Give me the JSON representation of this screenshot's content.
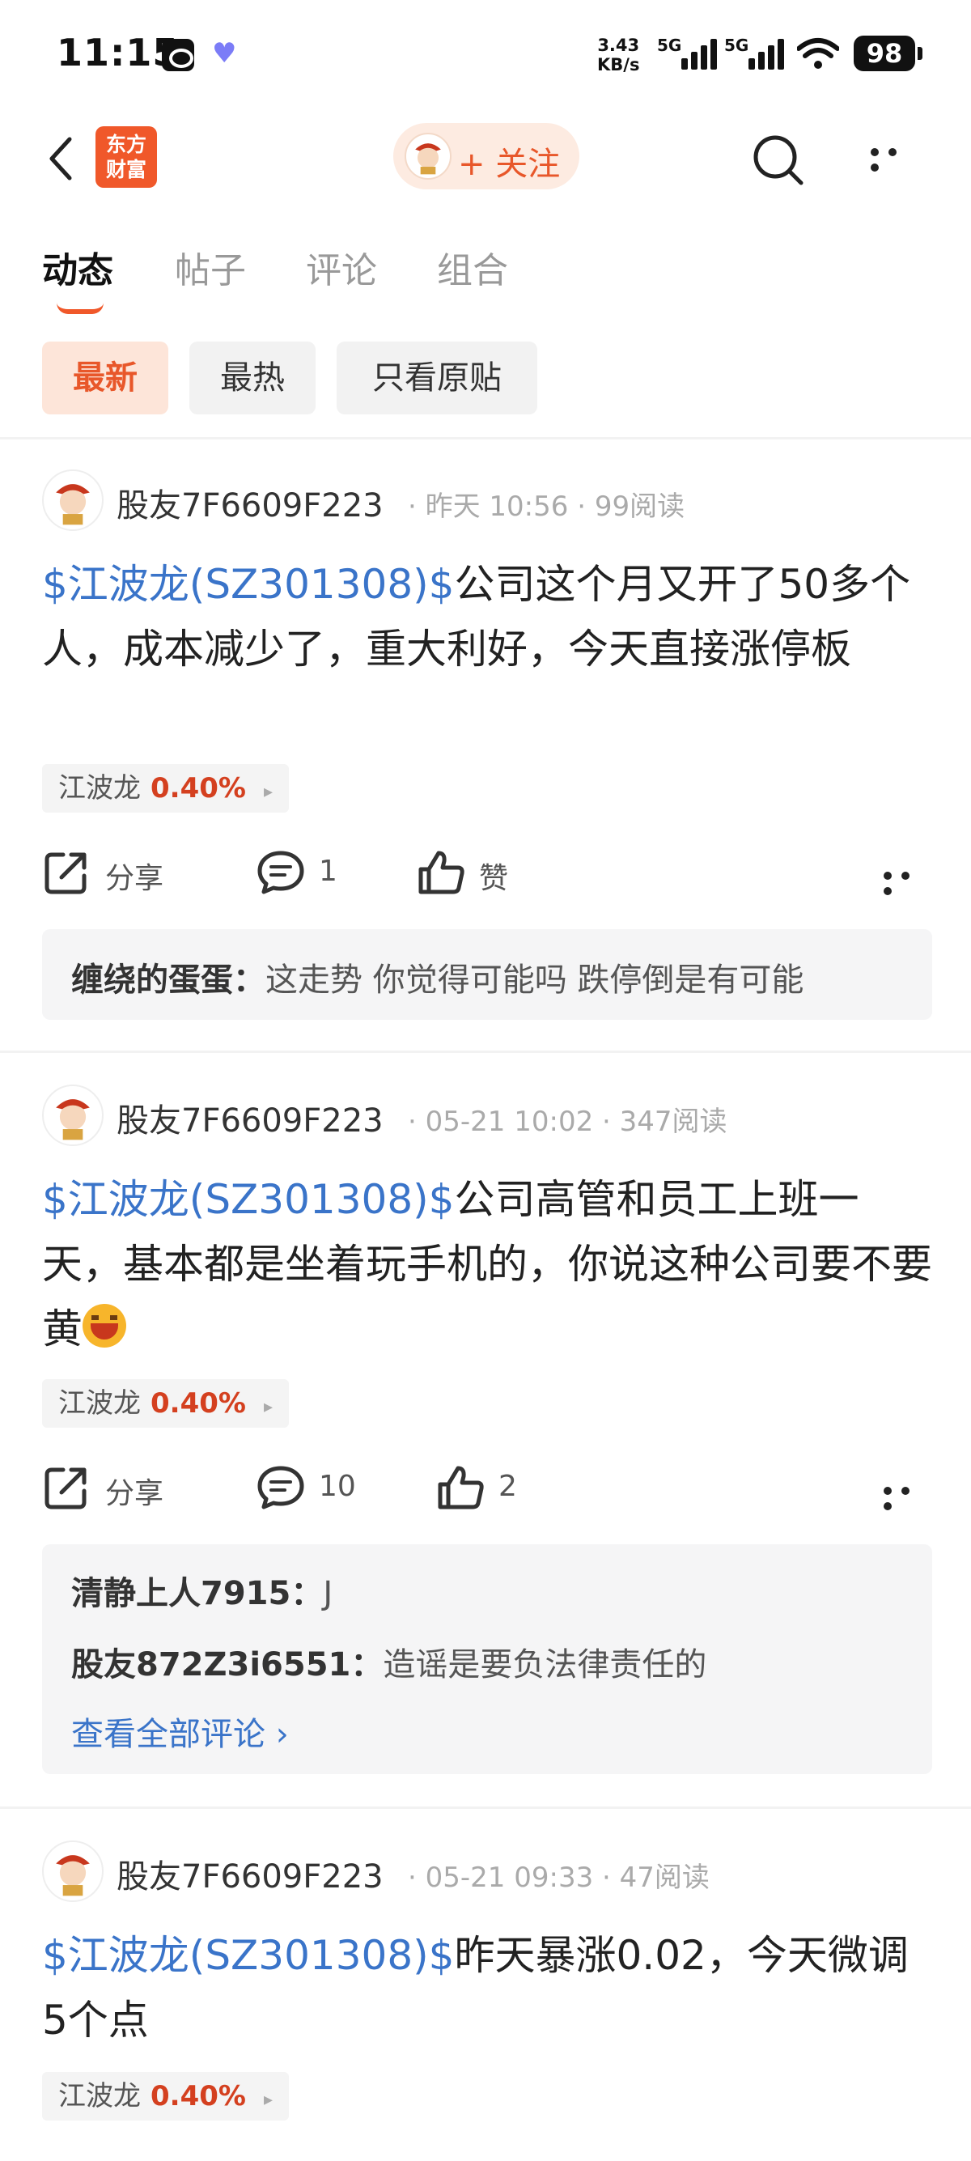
{
  "status_bar": {
    "time": "11:15",
    "net_speed_value": "3.43",
    "net_speed_unit": "KB/s",
    "signal1_label": "5G",
    "signal2_label": "5G",
    "battery": "98"
  },
  "nav": {
    "brand_line1": "东方",
    "brand_line2": "财富",
    "follow_label": "+ 关注"
  },
  "tabs": [
    {
      "label": "动态",
      "active": true
    },
    {
      "label": "帖子"
    },
    {
      "label": "评论"
    },
    {
      "label": "组合"
    }
  ],
  "filters": [
    {
      "label": "最新",
      "active": true
    },
    {
      "label": "最热"
    },
    {
      "label": "只看原贴"
    }
  ],
  "posts": [
    {
      "author": "股友7F6609F223",
      "meta": "· 昨天 10:56 · 99阅读",
      "stock_tag": "$江波龙(SZ301308)$",
      "text": "公司这个月又开了50多个人，成本减少了，重大利好，今天直接涨停板",
      "stock_name": "江波龙",
      "stock_change": "0.40%",
      "share_label": "分享",
      "comment_count": "1",
      "like_label": "赞",
      "comments": [
        {
          "user": "缠绕的蛋蛋：",
          "text": "这走势 你觉得可能吗 跌停倒是有可能"
        }
      ]
    },
    {
      "author": "股友7F6609F223",
      "meta": "· 05-21 10:02 · 347阅读",
      "stock_tag": "$江波龙(SZ301308)$",
      "text": "公司高管和员工上班一天，基本都是坐着玩手机的，你说这种公司要不要黄",
      "stock_name": "江波龙",
      "stock_change": "0.40%",
      "share_label": "分享",
      "comment_count": "10",
      "like_label": "2",
      "comments": [
        {
          "user": "清静上人7915：",
          "text": "J"
        },
        {
          "user": "股友872Z3i6551：",
          "text": "造谣是要负法律责任的"
        }
      ],
      "view_all": "查看全部评论 ›"
    },
    {
      "author": "股友7F6609F223",
      "meta": "· 05-21 09:33 · 47阅读",
      "stock_tag": "$江波龙(SZ301308)$",
      "text": "昨天暴涨0.02，今天微调5个点",
      "stock_name": "江波龙",
      "stock_change": "0.40%"
    }
  ]
}
